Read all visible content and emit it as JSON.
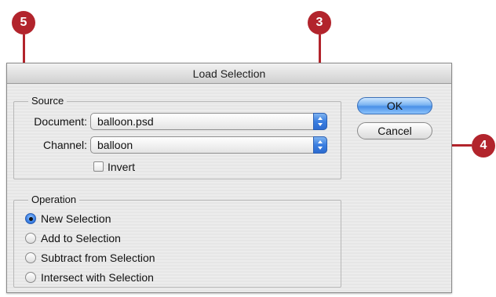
{
  "dialog": {
    "title": "Load Selection",
    "source": {
      "group_label": "Source",
      "document_label": "Document:",
      "document_value": "balloon.psd",
      "channel_label": "Channel:",
      "channel_value": "balloon",
      "invert_label": "Invert",
      "invert_checked": false
    },
    "operation": {
      "group_label": "Operation",
      "options": [
        {
          "label": "New Selection",
          "selected": true
        },
        {
          "label": "Add to Selection",
          "selected": false
        },
        {
          "label": "Subtract from Selection",
          "selected": false
        },
        {
          "label": "Intersect with Selection",
          "selected": false
        }
      ]
    },
    "buttons": {
      "ok": "OK",
      "cancel": "Cancel"
    }
  },
  "callouts": [
    "5",
    "3",
    "4"
  ],
  "colors": {
    "callout": "#b2242c",
    "accent": "#4a90e8"
  }
}
